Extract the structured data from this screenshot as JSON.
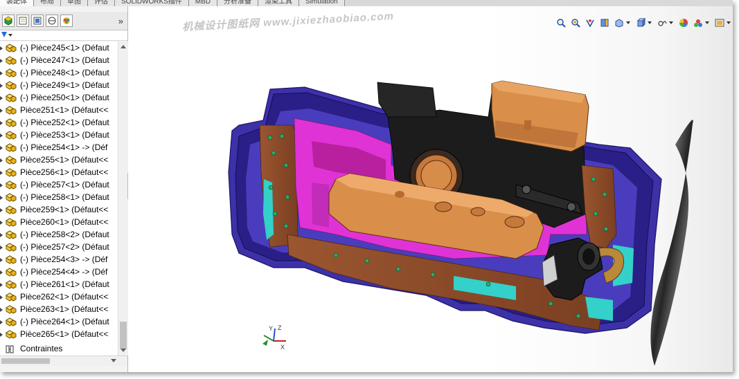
{
  "tabs": [
    "装配体",
    "布局",
    "草图",
    "评估",
    "SOLIDWORKS插件",
    "MBD",
    "分析准备",
    "渲染工具",
    "Simulation"
  ],
  "panel": {
    "more_label": "»"
  },
  "tree": {
    "items": [
      {
        "label": "(-) Pièce245<1> (Défaut"
      },
      {
        "label": "(-) Pièce247<1> (Défaut"
      },
      {
        "label": "(-) Pièce248<1> (Défaut"
      },
      {
        "label": "(-) Pièce249<1> (Défaut"
      },
      {
        "label": "(-) Pièce250<1> (Défaut"
      },
      {
        "label": "Pièce251<1> (Défaut<<"
      },
      {
        "label": "(-) Pièce252<1> (Défaut"
      },
      {
        "label": "(-) Pièce253<1> (Défaut"
      },
      {
        "label": "(-) Pièce254<1> -> (Déf"
      },
      {
        "label": "Pièce255<1> (Défaut<<"
      },
      {
        "label": "Pièce256<1> (Défaut<<"
      },
      {
        "label": "(-) Pièce257<1> (Défaut"
      },
      {
        "label": "(-) Pièce258<1> (Défaut"
      },
      {
        "label": "Pièce259<1> (Défaut<<"
      },
      {
        "label": "Pièce260<1> (Défaut<<"
      },
      {
        "label": "(-) Pièce258<2> (Défaut"
      },
      {
        "label": "(-) Pièce257<2> (Défaut"
      },
      {
        "label": "(-) Pièce254<3> -> (Déf"
      },
      {
        "label": "(-) Pièce254<4> -> (Déf"
      },
      {
        "label": "(-) Pièce261<1> (Défaut"
      },
      {
        "label": "Pièce262<1> (Défaut<<"
      },
      {
        "label": "Pièce263<1> (Défaut<<"
      },
      {
        "label": "(-) Pièce264<1> (Défaut"
      },
      {
        "label": "Pièce265<1> (Défaut<<"
      }
    ],
    "constraints_label": "Contraintes"
  },
  "watermark": "机械设计图纸网 www.jixiezhaobiao.com",
  "triad": {
    "x": "X",
    "y": "Y",
    "z": "Z"
  },
  "colors": {
    "housing": "#3a2ea0",
    "housing_dark": "#241a78",
    "magenta": "#e033d6",
    "orange": "#d98f4a",
    "pcb": "#8a4b2c",
    "cyan": "#33d1c9",
    "black_part": "#1c1c1c"
  },
  "icons": {
    "hud": [
      "zoom-to-fit-icon",
      "zoom-area-icon",
      "previous-view-icon",
      "section-view-icon",
      "view-orientation-icon",
      "display-style-icon",
      "hide-show-icon",
      "appearance-icon",
      "scene-icon",
      "view-settings-icon"
    ]
  }
}
